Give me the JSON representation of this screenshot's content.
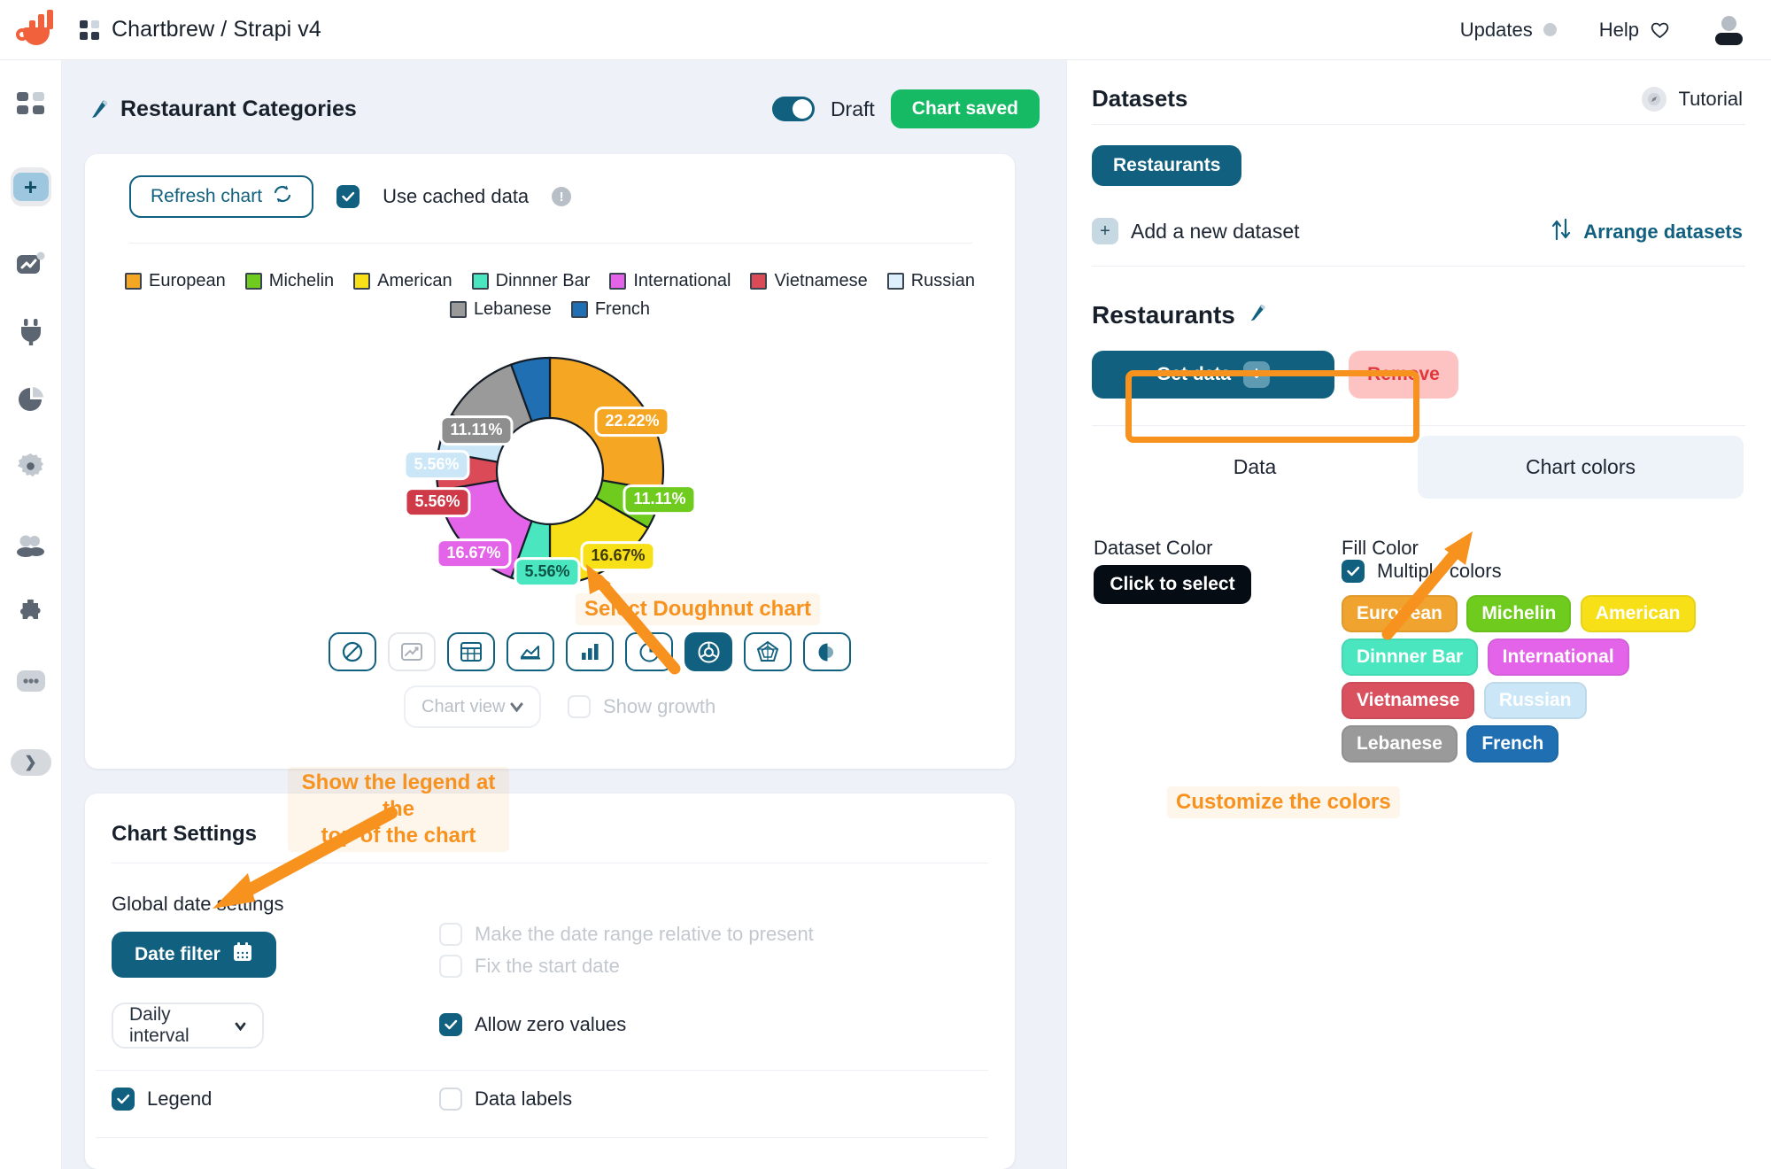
{
  "topbar": {
    "breadcrumb": "Chartbrew / Strapi v4",
    "updates_label": "Updates",
    "help_label": "Help"
  },
  "sidebar": {
    "items": [
      {
        "name": "dashboard",
        "icon": "grid-icon"
      },
      {
        "name": "add",
        "icon": "plus-icon"
      },
      {
        "name": "charts",
        "icon": "chart-line-icon"
      },
      {
        "name": "connections",
        "icon": "plug-icon"
      },
      {
        "name": "datasets",
        "icon": "pie-chart-icon"
      },
      {
        "name": "settings",
        "icon": "gear-icon"
      },
      {
        "name": "team",
        "icon": "users-icon"
      },
      {
        "name": "integrations",
        "icon": "puzzle-icon"
      },
      {
        "name": "more",
        "icon": "ellipsis-icon"
      },
      {
        "name": "expand",
        "icon": "chevron-right-icon"
      }
    ]
  },
  "editor": {
    "title": "Restaurant Categories",
    "draft_label": "Draft",
    "save_label": "Chart saved",
    "refresh_label": "Refresh chart",
    "cached_label": "Use cached data",
    "chart_view_placeholder": "Chart view",
    "show_growth_label": "Show growth",
    "chart_types": [
      {
        "name": "no-chart",
        "state": "outline"
      },
      {
        "name": "line-chart",
        "state": "disabled"
      },
      {
        "name": "table-chart",
        "state": "outline"
      },
      {
        "name": "area-chart",
        "state": "outline"
      },
      {
        "name": "bar-chart",
        "state": "outline"
      },
      {
        "name": "pie-chart",
        "state": "outline"
      },
      {
        "name": "doughnut-chart",
        "state": "active"
      },
      {
        "name": "radar-chart",
        "state": "outline"
      },
      {
        "name": "polar-chart",
        "state": "outline"
      }
    ]
  },
  "chart_data": {
    "type": "pie",
    "variant": "doughnut",
    "title": "Restaurant Categories",
    "legend_position": "top",
    "labels": [
      "European",
      "Michelin",
      "American",
      "Dinnner Bar",
      "International",
      "Vietnamese",
      "Russian",
      "Lebanese",
      "French"
    ],
    "values": [
      22.22,
      11.11,
      16.67,
      5.56,
      16.67,
      5.56,
      5.56,
      11.11,
      5.56
    ],
    "data_labels": [
      "22.22%",
      "11.11%",
      "16.67%",
      "5.56%",
      "16.67%",
      "5.56%",
      "5.56%",
      "11.11%",
      ""
    ],
    "colors": [
      "#f5a623",
      "#6fcc1f",
      "#f7e017",
      "#49e6c0",
      "#e364e8",
      "#db4a57",
      "#cbe7f7",
      "#9a9a9a",
      "#1f6fb2"
    ],
    "legend": [
      "European",
      "Michelin",
      "American",
      "Dinnner Bar",
      "International",
      "Vietnamese",
      "Russian",
      "Lebanese",
      "French"
    ]
  },
  "settings": {
    "section_title": "Chart Settings",
    "global_date_label": "Global date settings",
    "date_filter_label": "Date filter",
    "relative_range_label": "Make the date range relative to present",
    "fix_start_label": "Fix the start date",
    "interval_value": "Daily interval",
    "allow_zero_label": "Allow zero values",
    "legend_label": "Legend",
    "data_labels_label": "Data labels"
  },
  "datasets_panel": {
    "title": "Datasets",
    "tutorial_label": "Tutorial",
    "dataset_pill": "Restaurants",
    "add_dataset_label": "Add a new dataset",
    "arrange_label": "Arrange datasets",
    "dataset_name": "Restaurants",
    "get_data_label": "Get data",
    "remove_label": "Remove",
    "tabs": [
      {
        "label": "Data",
        "selected": false
      },
      {
        "label": "Chart colors",
        "selected": true
      }
    ],
    "dataset_color_label": "Dataset Color",
    "click_to_select_label": "Click to select",
    "fill_color_label": "Fill Color",
    "multiple_colors_label": "Multiple colors",
    "color_chips": [
      {
        "label": "European",
        "color": "#f0a32e"
      },
      {
        "label": "Michelin",
        "color": "#6fcc1f"
      },
      {
        "label": "American",
        "color": "#f7e017"
      },
      {
        "label": "Dinnner Bar",
        "color": "#49e6c0"
      },
      {
        "label": "International",
        "color": "#e364e8"
      },
      {
        "label": "Vietnamese",
        "color": "#d9515f"
      },
      {
        "label": "Russian",
        "color": "#cbe7f7"
      },
      {
        "label": "Lebanese",
        "color": "#9a9a9a"
      },
      {
        "label": "French",
        "color": "#1f6fb2"
      }
    ]
  },
  "annotations": {
    "select_doughnut": "Select Doughnut chart",
    "legend_top_line1": "Show the legend at the",
    "legend_top_line2": "top of the chart",
    "customize_colors": "Customize the colors",
    "accent": "#f7921e"
  }
}
